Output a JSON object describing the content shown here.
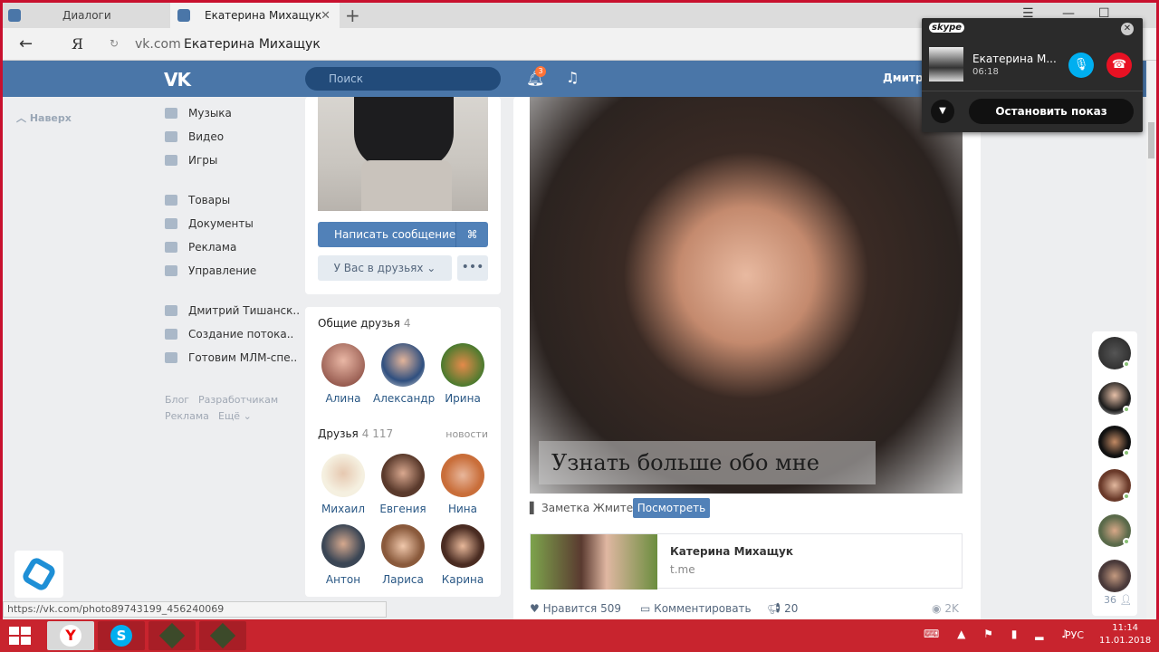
{
  "browser": {
    "tabs": [
      {
        "label": "Диалоги"
      },
      {
        "label": "Екатерина Михащук"
      }
    ],
    "new_tab": "+",
    "browser_logo": "Я",
    "url": "vk.com",
    "page_title": "Екатерина Михащук",
    "status_url": "https://vk.com/photo89743199_456240069"
  },
  "header": {
    "logo": "VK",
    "search_placeholder": "Поиск",
    "notifications_count": "3",
    "user_name": "Дмитри"
  },
  "left_menu": {
    "up": "Наверх",
    "items": [
      {
        "label": "Музыка",
        "icon": "music-icon"
      },
      {
        "label": "Видео",
        "icon": "video-icon"
      },
      {
        "label": "Игры",
        "icon": "games-icon"
      },
      {
        "label": "Товары",
        "icon": "goods-icon"
      },
      {
        "label": "Документы",
        "icon": "documents-icon"
      },
      {
        "label": "Реклама",
        "icon": "ads-icon"
      },
      {
        "label": "Управление",
        "icon": "manage-icon"
      }
    ],
    "groups": [
      {
        "label": "Дмитрий Тишанск.."
      },
      {
        "label": "Создание потока.."
      },
      {
        "label": "Готовим МЛМ-спе.."
      }
    ],
    "footer": {
      "blog": "Блог",
      "dev": "Разработчикам",
      "ads": "Реклама",
      "more": "Ещё"
    }
  },
  "profile": {
    "message_button": "Написать сообщение",
    "friends_button": "У Вас в друзьях",
    "more_button": "•••",
    "mutual_title": "Общие друзья",
    "mutual_count": "4",
    "mutual": [
      {
        "name": "Алина"
      },
      {
        "name": "Александр"
      },
      {
        "name": "Ирина"
      }
    ],
    "friends_title": "Друзья",
    "friends_count": "4 117",
    "friends_link": "новости",
    "friends": [
      {
        "name": "Михаил"
      },
      {
        "name": "Евгения"
      },
      {
        "name": "Нина"
      },
      {
        "name": "Антон"
      },
      {
        "name": "Лариса"
      },
      {
        "name": "Карина"
      }
    ]
  },
  "post": {
    "caption": "Узнать больше обо мне",
    "note_label": "Заметка Жмите",
    "view_button": "Посмотреть",
    "link_title": "Катерина Михащук",
    "link_domain": "t.me",
    "likes_label": "Нравится",
    "likes_count": "509",
    "comment_label": "Комментировать",
    "shares_count": "20",
    "views_count": "2K"
  },
  "skype": {
    "logo": "skype",
    "caller": "Екатерина М...",
    "duration": "06:18",
    "stop_button": "Остановить показ"
  },
  "chat": {
    "online_count": "36"
  },
  "taskbar": {
    "language": "РУС",
    "time": "11:14",
    "date": "11.01.2018"
  },
  "colors": {
    "vk_blue": "#4a76a8",
    "button_blue": "#5181b8",
    "taskbar": "#c8242e",
    "skype_blue": "#00aff0",
    "hangup_red": "#e81123"
  }
}
